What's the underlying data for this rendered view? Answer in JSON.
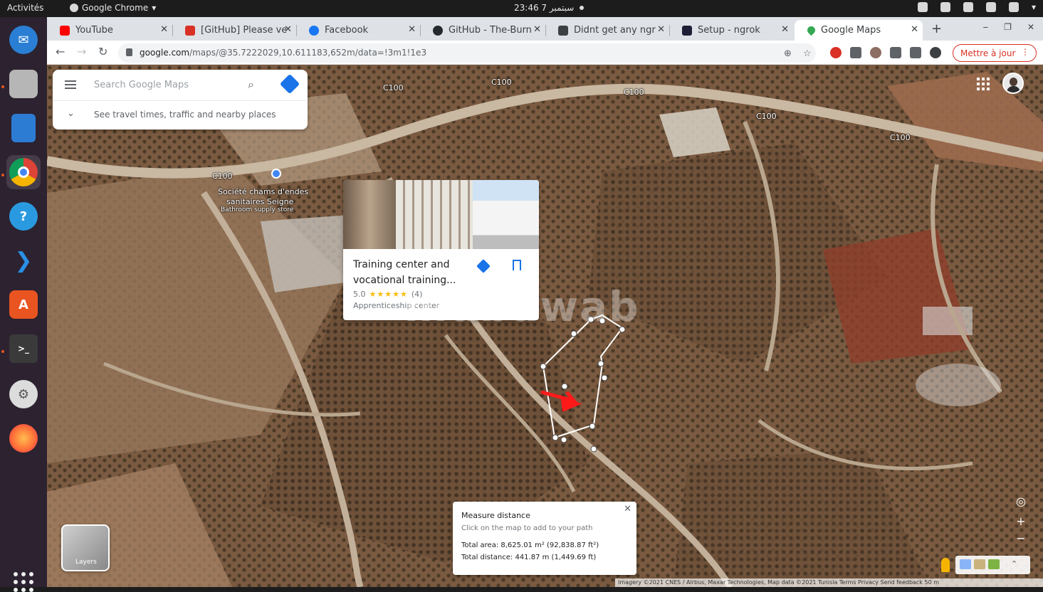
{
  "os": {
    "activities": "Activités",
    "app_menu": "Google Chrome",
    "clock": "23:46  7 سبتمبر"
  },
  "tabs": [
    {
      "label": "YouTube",
      "favicon_color": "#ff0000"
    },
    {
      "label": "[GitHub] Please ve",
      "favicon_color": "#d93025"
    },
    {
      "label": "Facebook",
      "favicon_color": "#1877f2"
    },
    {
      "label": "GitHub - The-Burn",
      "favicon_color": "#24292e"
    },
    {
      "label": "Didnt get any ngr",
      "favicon_color": "#3c4043"
    },
    {
      "label": "Setup - ngrok",
      "favicon_color": "#1f1e37"
    },
    {
      "label": "Google Maps",
      "favicon_color": "#34a853"
    }
  ],
  "toolbar": {
    "url_host": "google.com",
    "url_path": "/maps/@35.7222029,10.611183,652m/data=!3m1!1e3",
    "update_label": "Mettre à jour"
  },
  "search": {
    "placeholder": "Search Google Maps",
    "hint": "See travel times, traffic and nearby places"
  },
  "map_labels": {
    "road1": "C100",
    "road2": "C100",
    "road3": "C100",
    "road4": "C100",
    "road5": "C100",
    "road6": "C100",
    "poi_line1": "Société chams d'endes",
    "poi_line2": "sanitaires Seigne",
    "poi_line3": "Bathroom supply store"
  },
  "place_card": {
    "name": "Training center and vocational training...",
    "rating": "5.0",
    "stars": "★★★★★",
    "reviews": "(4)",
    "type": "Apprenticeship center"
  },
  "watermark": "mubawab",
  "measure": {
    "title": "Measure distance",
    "hint": "Click on the map to add to your path",
    "area": "Total area: 8,625.01 m² (92,838.87 ft²)",
    "distance": "Total distance: 441.87 m (1,449.69 ft)"
  },
  "layers_label": "Layers",
  "attribution": "Imagery ©2021 CNES / Airbus, Maxar Technologies, Map data ©2021   Tunisia   Terms   Privacy   Send feedback   50 m"
}
